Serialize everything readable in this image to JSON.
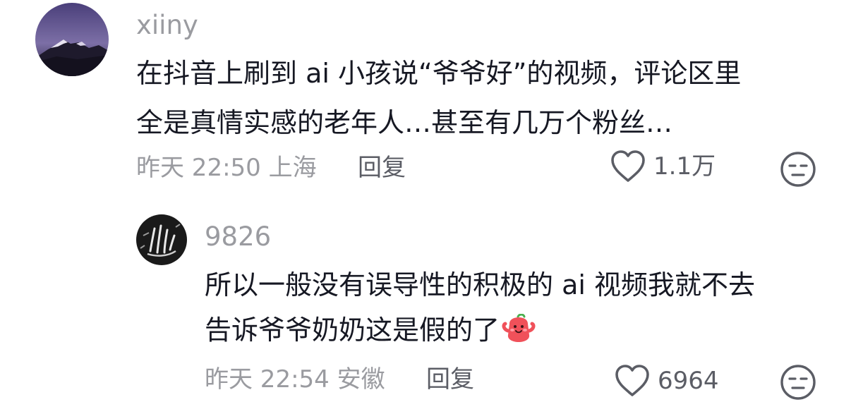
{
  "comments": [
    {
      "username": "xiiny",
      "lines": [
        "在抖音上刷到 ai 小孩说“爷爷好”的视频，评论区里",
        "全是真情实感的老年人…甚至有几万个粉丝…"
      ],
      "time": "昨天 22:50 上海",
      "reply_label": "回复",
      "likes": "1.1万",
      "avatar_icon": "mountain-avatar"
    },
    {
      "username": "9826",
      "lines": [
        "所以一般没有误导性的积极的 ai 视频我就不去",
        "告诉爷爷奶奶这是假的了"
      ],
      "emoji": "smiling-creature-emoji",
      "time": "昨天 22:54 安徽",
      "reply_label": "回复",
      "likes": "6964",
      "avatar_icon": "hand-sketch-avatar"
    }
  ],
  "icons": {
    "like": "heart-outline-icon",
    "dislike": "unamused-face-icon"
  },
  "colors": {
    "text_primary": "#161823",
    "text_secondary": "#9a9ba0",
    "text_action": "#5b5d65",
    "emoji_red": "#f0515a"
  }
}
